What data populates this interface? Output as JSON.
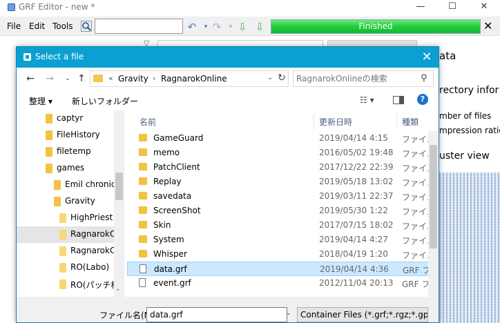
{
  "app": {
    "title": "GRF Editor - new *",
    "menu": [
      "File",
      "Edit",
      "Tools"
    ],
    "search_value": "",
    "progress_label": "Finished",
    "window_controls": {
      "minimize": "—",
      "maximize": "☐",
      "close": "✕"
    },
    "right_panel": {
      "heading": "ata",
      "section1": "rectory infor",
      "line1": "mber of files",
      "line2": "mpression ratio",
      "section2": "uster view"
    }
  },
  "dialog": {
    "title": "Select a file",
    "close_glyph": "✕",
    "address": {
      "overflow": "«",
      "parts": [
        "Gravity",
        "RagnarokOnline"
      ],
      "separator": "›"
    },
    "search_placeholder": "RagnarokOnlineの検索",
    "toolbar": {
      "organize": "整理 ▾",
      "new_folder": "新しいフォルダー",
      "view_glyph": "☷ ▾",
      "help": "?"
    },
    "tree": [
      {
        "label": "captyr",
        "indent": 0,
        "selected": false
      },
      {
        "label": "FileHistory",
        "indent": 0,
        "selected": false
      },
      {
        "label": "filetemp",
        "indent": 0,
        "selected": false
      },
      {
        "label": "games",
        "indent": 0,
        "selected": false
      },
      {
        "label": "Emil chronicle",
        "indent": 1,
        "selected": false
      },
      {
        "label": "Gravity",
        "indent": 1,
        "selected": false
      },
      {
        "label": "HighPriest",
        "indent": 2,
        "selected": false
      },
      {
        "label": "RagnarokOnline",
        "indent": 2,
        "selected": true
      },
      {
        "label": "RagnarokOnline",
        "indent": 2,
        "selected": false
      },
      {
        "label": "RO(Labo)",
        "indent": 2,
        "selected": false
      },
      {
        "label": "RO(パッチ検証",
        "indent": 2,
        "selected": false
      }
    ],
    "columns": {
      "name": "名前",
      "date": "更新日時",
      "type": "種類"
    },
    "files": [
      {
        "name": "GameGuard",
        "date": "2019/04/14 4:15",
        "type": "ファイル",
        "kind": "folder",
        "selected": false
      },
      {
        "name": "memo",
        "date": "2016/05/02 19:48",
        "type": "ファイル",
        "kind": "folder",
        "selected": false
      },
      {
        "name": "PatchClient",
        "date": "2017/12/22 22:39",
        "type": "ファイル",
        "kind": "folder",
        "selected": false
      },
      {
        "name": "Replay",
        "date": "2019/05/18 13:02",
        "type": "ファイル",
        "kind": "folder",
        "selected": false
      },
      {
        "name": "savedata",
        "date": "2019/03/11 22:37",
        "type": "ファイル",
        "kind": "folder",
        "selected": false
      },
      {
        "name": "ScreenShot",
        "date": "2019/05/30 1:22",
        "type": "ファイル",
        "kind": "folder",
        "selected": false
      },
      {
        "name": "Skin",
        "date": "2017/07/15 18:02",
        "type": "ファイル",
        "kind": "folder",
        "selected": false
      },
      {
        "name": "System",
        "date": "2019/04/14 4:27",
        "type": "ファイル",
        "kind": "folder",
        "selected": false
      },
      {
        "name": "Whisper",
        "date": "2018/04/19 1:20",
        "type": "ファイル",
        "kind": "folder",
        "selected": false
      },
      {
        "name": "data.grf",
        "date": "2019/04/14 4:36",
        "type": "GRF ファ",
        "kind": "file",
        "selected": true
      },
      {
        "name": "event.grf",
        "date": "2012/11/04 20:13",
        "type": "GRF ファ",
        "kind": "file",
        "selected": false
      }
    ],
    "filename_label": "ファイル名(N):",
    "filename_value": "data.grf",
    "filetype_value": "Container Files (*.grf;*.rgz;*.gpf;*"
  }
}
